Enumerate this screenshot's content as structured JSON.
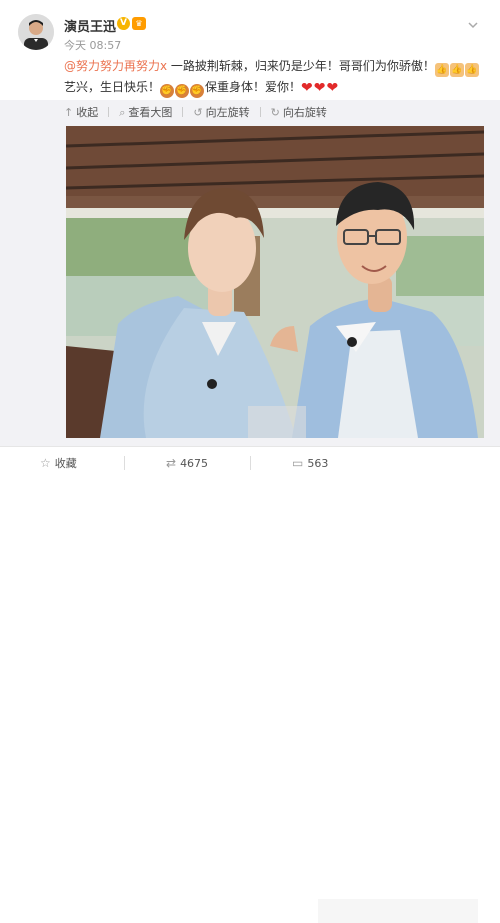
{
  "post": {
    "author_name": "演员王迅",
    "vip_mark": "V",
    "time": "今天 08:57",
    "mention": "@努力努力再努力x",
    "text_part1": " 一路披荆斩棘，归来仍是少年！哥哥们为你骄傲！",
    "text_part2": "艺兴，生日快乐！",
    "text_part3": "保重身体！爱你！"
  },
  "image_toolbar": {
    "collapse": "收起",
    "view_large": "查看大图",
    "rotate_left": "向左旋转",
    "rotate_right": "向右旋转"
  },
  "actions": {
    "favorite": "收藏",
    "repost_count": "4675",
    "comment_count": "563"
  },
  "icons": {
    "menu": "chevron-down-icon",
    "collapse": "collapse-icon",
    "view_large": "magnifier-icon",
    "rotate_left": "rotate-left-icon",
    "rotate_right": "rotate-right-icon",
    "favorite": "star-icon",
    "repost": "repost-icon",
    "comment": "comment-icon"
  },
  "colors": {
    "mention": "#eb7350",
    "heart": "#e22a2a",
    "vip": "#f7b500"
  }
}
